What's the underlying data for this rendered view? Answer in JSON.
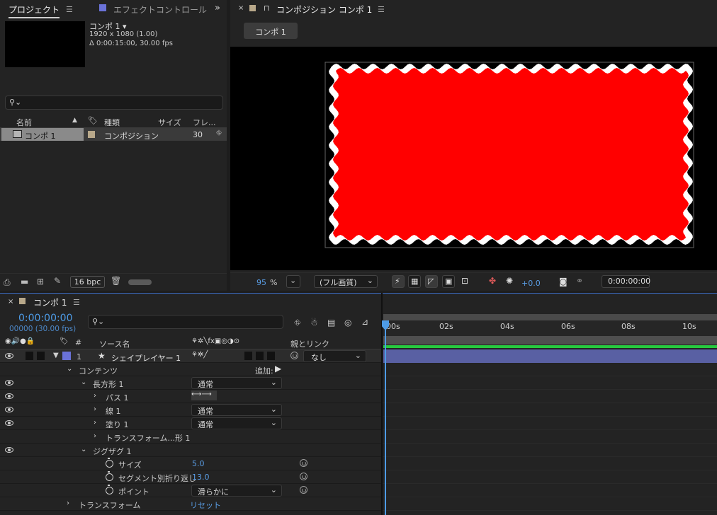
{
  "project": {
    "tab_label": "プロジェクト",
    "effect_tab_label": "エフェクトコントロール",
    "comp_name": "コンポ 1 ▾",
    "comp_res": "1920 x 1080 (1.00)",
    "comp_dur": "Δ 0:00:15:00, 30.00 fps",
    "search_placeholder": "",
    "columns": {
      "name": "名前",
      "type": "種類",
      "size": "サイズ",
      "frame": "フレ..."
    },
    "item": {
      "name": "コンポ 1",
      "type": "コンポジション",
      "frame": "30"
    },
    "bpc_label": "16 bpc"
  },
  "comp_panel": {
    "tab_label": "コンポジション コンポ 1",
    "breadcrumb": "コンポ 1",
    "zoom_value": "95",
    "zoom_unit": "%",
    "quality": "(フル画質)",
    "exposure": "+0.0",
    "timecode": "0:00:00:00",
    "accent_red": "#ff0000"
  },
  "timeline": {
    "tab_label": "コンポ 1",
    "timecode": "0:00:00:00",
    "frames": "00000 (30.00 fps)",
    "search_placeholder": "",
    "col_hash": "#",
    "col_source": "ソース名",
    "col_parent": "親とリンク",
    "layer_num": "1",
    "layer_name": "シェイプレイヤー 1",
    "parent_value": "なし",
    "contents": "コンテンツ",
    "add_label": "追加:",
    "rect": "長方形 1",
    "rect_mode": "通常",
    "path": "パス 1",
    "stroke": "線 1",
    "stroke_mode": "通常",
    "fill": "塗り 1",
    "fill_mode": "通常",
    "transform_shape": "トランスフォーム...形 1",
    "zigzag": "ジグザグ 1",
    "size_label": "サイズ",
    "size_value": "5.0",
    "ridges_label": "セグメント別折り返し",
    "ridges_value": "13.0",
    "points_label": "ポイント",
    "points_value": "滑らかに",
    "transform": "トランスフォーム",
    "reset": "リセット",
    "ticks": [
      "00s",
      "02s",
      "04s",
      "06s",
      "08s",
      "10s"
    ]
  }
}
